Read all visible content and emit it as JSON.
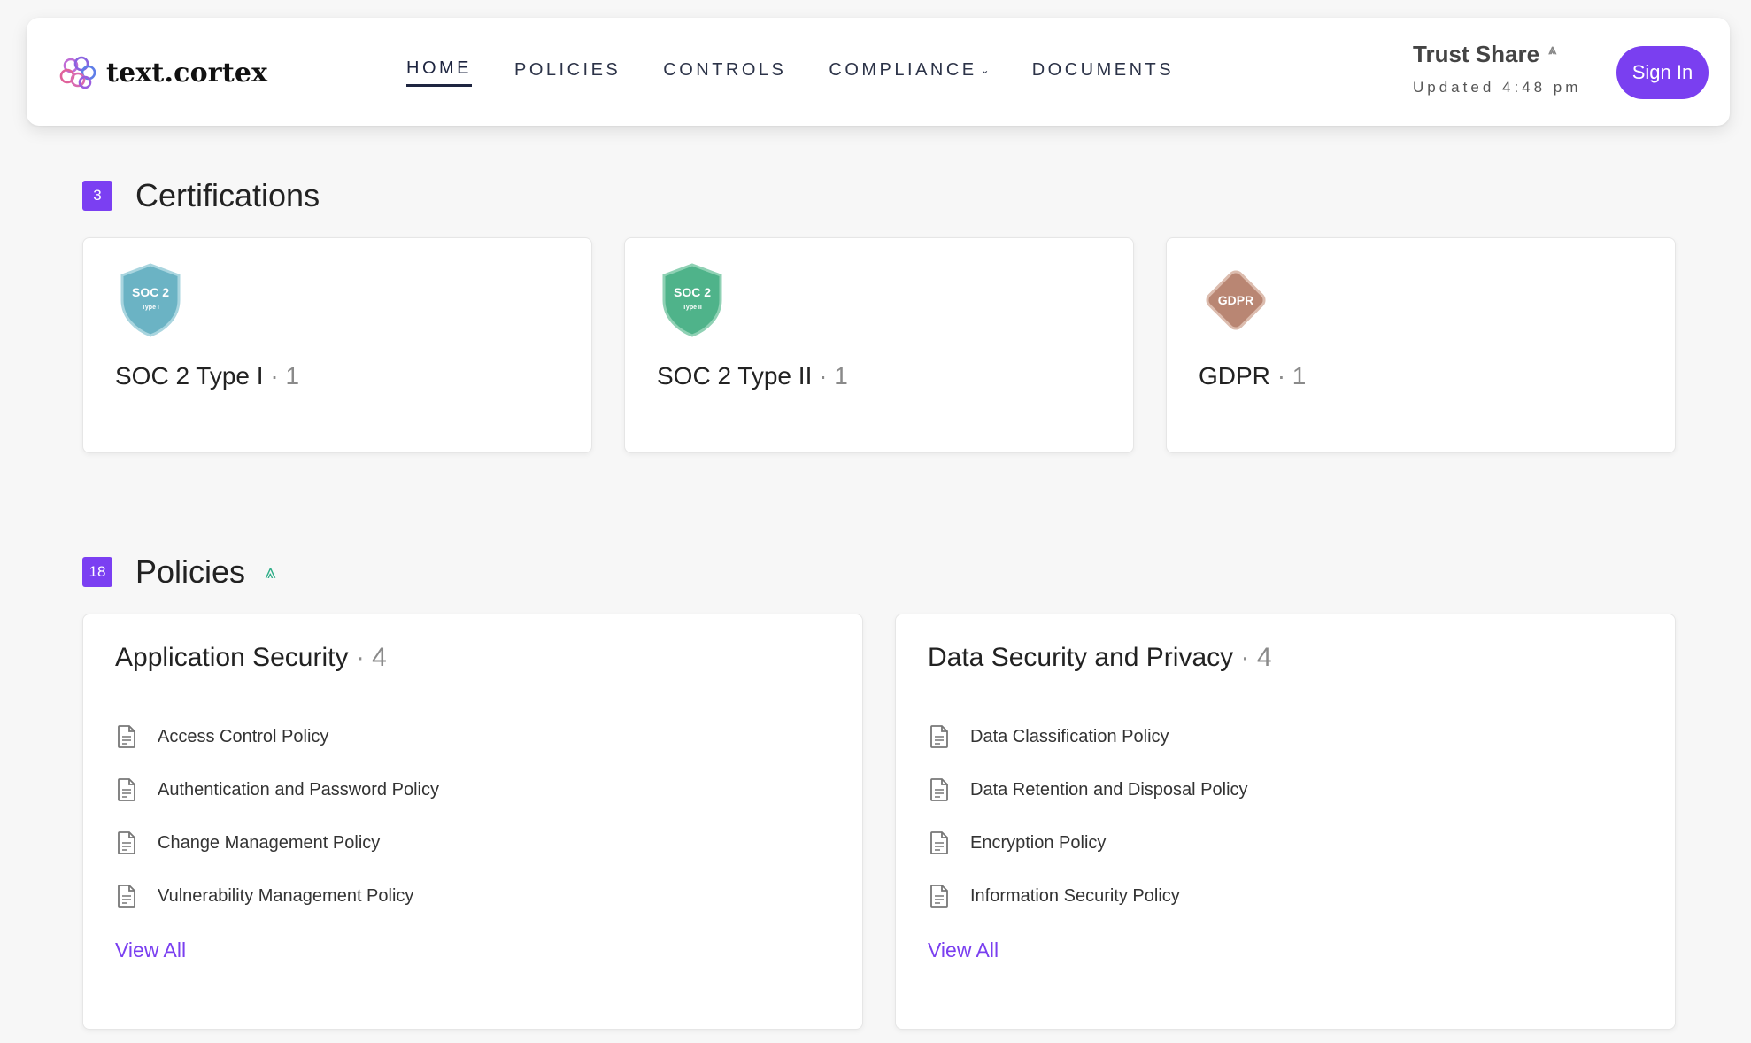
{
  "brand": {
    "name": "text.cortex"
  },
  "nav": {
    "items": [
      {
        "label": "HOME",
        "active": true
      },
      {
        "label": "POLICIES"
      },
      {
        "label": "CONTROLS"
      },
      {
        "label": "COMPLIANCE",
        "has_dropdown": true
      },
      {
        "label": "DOCUMENTS"
      }
    ]
  },
  "trust": {
    "title": "Trust Share",
    "updated": "Updated 4:48 pm"
  },
  "signin": {
    "label": "Sign In"
  },
  "certifications": {
    "count": "3",
    "title": "Certifications",
    "items": [
      {
        "label": "SOC 2 Type I",
        "dot": "·",
        "count": "1",
        "badge_line1": "SOC 2",
        "badge_line2": "Type I",
        "color": "#6bb3c4"
      },
      {
        "label": "SOC 2 Type II",
        "dot": "·",
        "count": "1",
        "badge_line1": "SOC 2",
        "badge_line2": "Type II",
        "color": "#4fb38a"
      },
      {
        "label": "GDPR",
        "dot": "·",
        "count": "1",
        "badge_line1": "GDPR",
        "color": "#b98673"
      }
    ]
  },
  "policies": {
    "count": "18",
    "title": "Policies",
    "groups": [
      {
        "title": "Application Security",
        "dot": "·",
        "count": "4",
        "items": [
          "Access Control Policy",
          "Authentication and Password Policy",
          "Change Management Policy",
          "Vulnerability Management Policy"
        ],
        "view_all": "View All"
      },
      {
        "title": "Data Security and Privacy",
        "dot": "·",
        "count": "4",
        "items": [
          "Data Classification Policy",
          "Data Retention and Disposal Policy",
          "Encryption Policy",
          "Information Security Policy"
        ],
        "view_all": "View All"
      }
    ]
  },
  "colors": {
    "accent": "#7a3ff0",
    "nav_text": "#2c3348",
    "spark": "#2fae88"
  }
}
